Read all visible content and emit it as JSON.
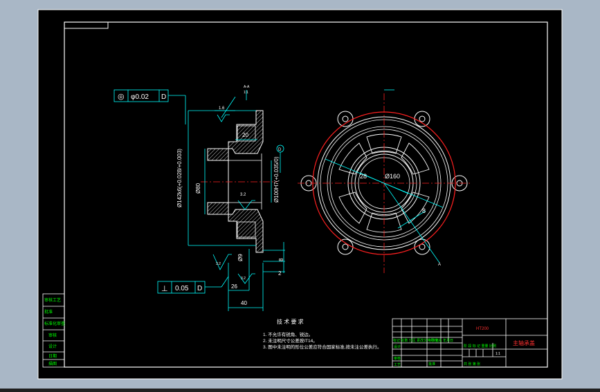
{
  "drawing": {
    "part_name": "主轴承盖",
    "material": "HT200",
    "scale": "1:1",
    "tech_title": "技 术 要 求",
    "tech_notes": [
      "1. 不允许有锐角、锐边。",
      "2. 未注明尺寸公差按IT14。",
      "3. 图中未注明的形位公差应符合国家标准,按未注公差执行。"
    ],
    "fcf_top": {
      "symbol": "◎",
      "value": "φ0.02",
      "datum": "D"
    },
    "fcf_bottom": {
      "symbol": "⊥",
      "value": "0.05",
      "datum": "D"
    },
    "section_label": "A-A",
    "section_scale": "1:1",
    "roughness_top": "1.6",
    "roughness_mid": "3.2",
    "roughness_low": "3.2",
    "roughness_low2": "3.2",
    "datum_circle": "D",
    "dims": {
      "d20": "20",
      "od": "Ø142k6(+0.028/+0.003)",
      "d80": "Ø80",
      "bore": "Ø100H7(+0.035/0)",
      "d9": "Ø9",
      "d26": "26",
      "d8": "8",
      "d2": "2",
      "d40": "40",
      "dim28": "28",
      "dim160": "Ø160",
      "dim8b": "8",
      "leader_a": "A"
    },
    "left_strip": [
      "审核工艺",
      "批准",
      "标准化审查",
      "审核",
      "设计",
      "日期",
      "描图"
    ],
    "title_block": {
      "row_labels": [
        "标记 处数 分区 更改文件号 签名 年月日",
        "设计",
        "审核",
        "工艺"
      ],
      "mid_labels": [
        "标准化",
        "",
        "",
        "批准"
      ],
      "stage_labels": "阶 段 标 记   重量  比例",
      "sheet_label": "共  张 第  张"
    }
  }
}
